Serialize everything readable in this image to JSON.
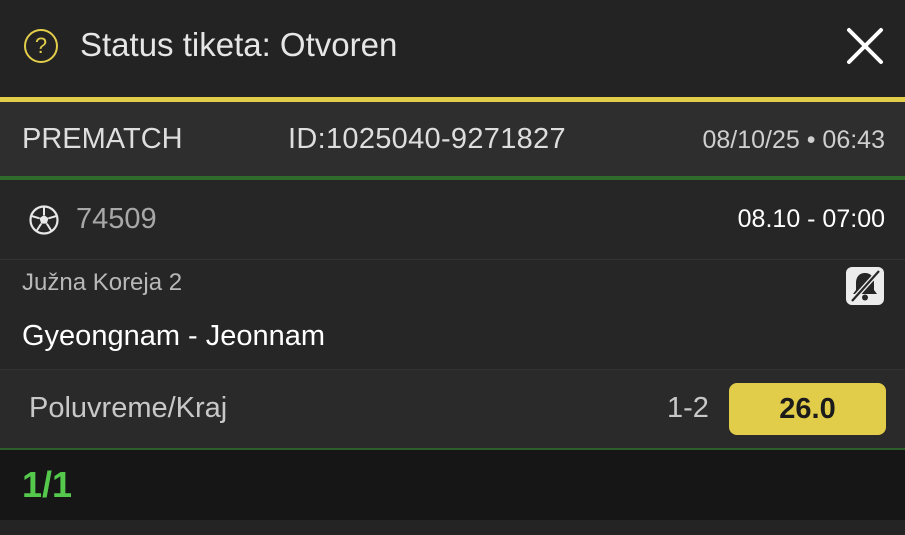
{
  "header": {
    "help_icon_glyph": "?",
    "title": "Status tiketa: Otvoren"
  },
  "ticket": {
    "type": "PREMATCH",
    "id": "ID:1025040-9271827",
    "datetime": "08/10/25 • 06:43"
  },
  "event": {
    "sport_icon": "soccer-ball-icon",
    "code": "74509",
    "time": "08.10  -  07:00",
    "league": "Južna Koreja 2",
    "notification_icon": "bell-off-icon",
    "match": "Gyeongnam - Jeonnam"
  },
  "bet": {
    "market": "Poluvreme/Kraj",
    "pick": "1-2",
    "odds": "26.0"
  },
  "footer": {
    "counter": "1/1"
  },
  "colors": {
    "accent_yellow": "#e2cd4a",
    "accent_green": "#54c94c",
    "background": "#1f1f1f"
  }
}
